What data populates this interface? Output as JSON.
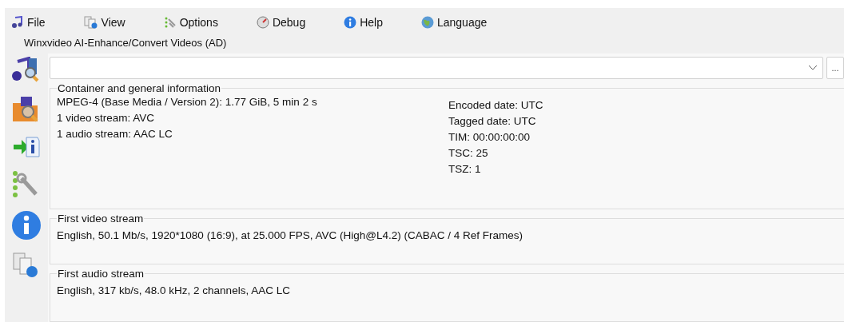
{
  "menu": [
    "File",
    "View",
    "Options",
    "Debug",
    "Help",
    "Language"
  ],
  "title": "Winxvideo AI-Enhance/Convert Videos (AD)",
  "file_box": {
    "button": "..."
  },
  "groups": [
    {
      "title": "Container and general information",
      "columns": [
        [
          "MPEG-4 (Base Media / Version 2): 1.77 GiB, 5 min 2 s",
          "1 video stream: AVC",
          "1 audio stream: AAC LC"
        ],
        [
          "Encoded date: UTC",
          "Tagged date: UTC",
          "TIM: 00:00:00:00",
          "TSC: 25",
          "TSZ: 1"
        ]
      ]
    },
    {
      "title": "First video stream",
      "columns": [
        [
          "English, 50.1 Mb/s, 1920*1080 (16:9), at 25.000 FPS, AVC (High@L4.2) (CABAC / 4 Ref Frames)"
        ]
      ]
    },
    {
      "title": "First audio stream",
      "columns": [
        [
          "English, 317 kb/s, 48.0 kHz, 2 channels, AAC LC"
        ]
      ]
    }
  ]
}
